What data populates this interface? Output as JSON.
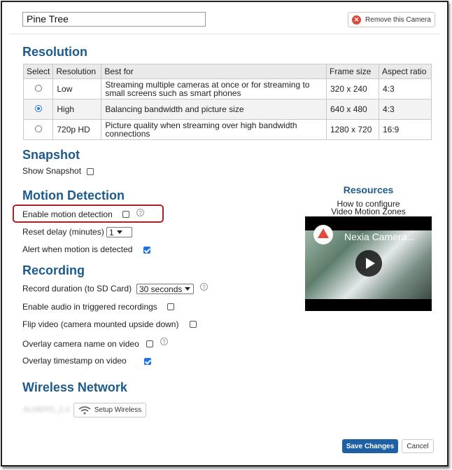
{
  "camera": {
    "name": "Pine Tree",
    "remove_label": "Remove this Camera"
  },
  "resolution": {
    "heading": "Resolution",
    "columns": [
      "Select",
      "Resolution",
      "Best for",
      "Frame size",
      "Aspect ratio"
    ],
    "rows": [
      {
        "selected": false,
        "resolution": "Low",
        "best_for": "Streaming multiple cameras at once or for streaming to small screens such as smart phones",
        "frame_size": "320 x 240",
        "aspect": "4:3"
      },
      {
        "selected": true,
        "resolution": "High",
        "best_for": "Balancing bandwidth and picture size",
        "frame_size": "640 x 480",
        "aspect": "4:3"
      },
      {
        "selected": false,
        "resolution": "720p HD",
        "best_for": "Picture quality when streaming over high bandwidth connections",
        "frame_size": "1280 x 720",
        "aspect": "16:9"
      }
    ]
  },
  "snapshot": {
    "heading": "Snapshot",
    "show_label": "Show Snapshot",
    "show_checked": false
  },
  "motion": {
    "heading": "Motion Detection",
    "enable_label": "Enable motion detection",
    "enable_checked": false,
    "reset_label": "Reset delay (minutes)",
    "reset_value": "1",
    "alert_label": "Alert when motion is detected",
    "alert_checked": true
  },
  "resources": {
    "heading": "Resources",
    "link_line1": "How to configure",
    "link_line2": "Video Motion Zones",
    "video_title": "Nexia Camera..."
  },
  "recording": {
    "heading": "Recording",
    "duration_label": "Record duration (to SD Card)",
    "duration_value": "30 seconds",
    "audio_label": "Enable audio in triggered recordings",
    "audio_checked": false,
    "flip_label": "Flip video (camera mounted upside down)",
    "flip_checked": false,
    "overlay_name_label": "Overlay camera name on video",
    "overlay_name_checked": false,
    "overlay_ts_label": "Overlay timestamp on video",
    "overlay_ts_checked": true
  },
  "wireless": {
    "heading": "Wireless Network",
    "ssid": "ALMERS_2.4",
    "setup_label": "Setup Wireless"
  },
  "footer": {
    "save_label": "Save Changes",
    "cancel_label": "Cancel"
  },
  "help_glyph": "?",
  "colors": {
    "accent": "#1d5b8c",
    "primary_button": "#1f5fa3",
    "highlight": "#b01e23",
    "check": "#1a73e8",
    "remove_icon": "#d94a3d"
  }
}
